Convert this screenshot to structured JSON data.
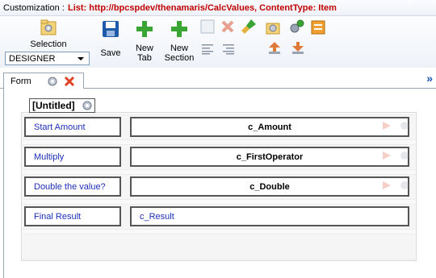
{
  "titlebar": {
    "label": "Customization :",
    "list_info": "List: http://bpcspdev/thenamaris/CalcValues, ContentType: Item"
  },
  "ribbon": {
    "selection_label": "Selection",
    "selection_value": "DESIGNER",
    "save_label": "Save",
    "new_tab_line1": "New",
    "new_tab_line2": "Tab",
    "new_section_line1": "New",
    "new_section_line2": "Section"
  },
  "tabs": [
    {
      "label": "Form"
    }
  ],
  "form": {
    "section_title": "[Untitled]",
    "rows": [
      {
        "label": "Start Amount",
        "field": "c_Amount"
      },
      {
        "label": "Multiply",
        "field": "c_FirstOperator"
      },
      {
        "label": "Double the value?",
        "field": "c_Double"
      },
      {
        "label": "Final Result",
        "field": "c_Result"
      }
    ]
  },
  "colors": {
    "list_info": "#c00000",
    "label_text": "#1c2fb8",
    "add_green": "#3aa535",
    "delete_red": "#e04020",
    "save_blue": "#1f5aa8"
  }
}
